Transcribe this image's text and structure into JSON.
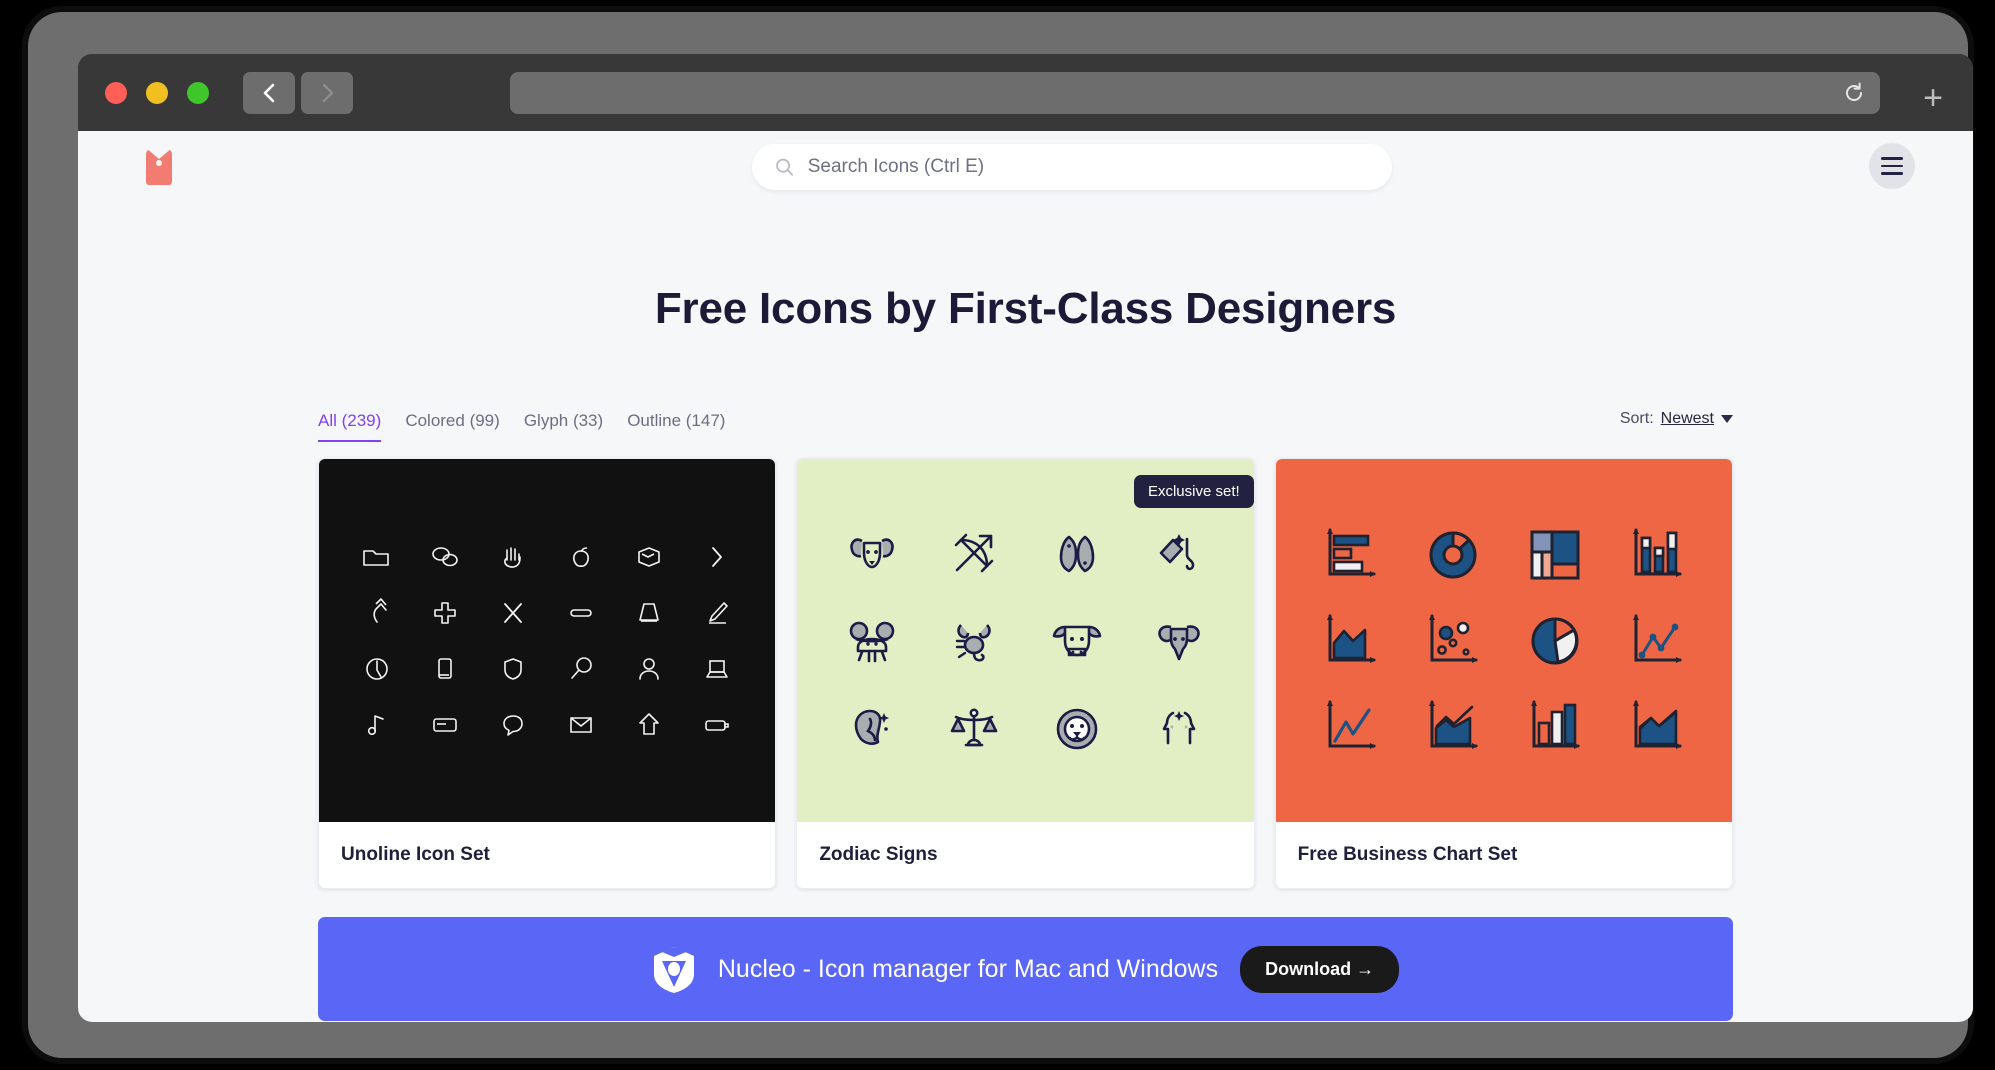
{
  "browser": {
    "traffic_lights": [
      "close",
      "minimize",
      "maximize"
    ],
    "back_label": "Back",
    "forward_label": "Forward",
    "url_value": "",
    "reload_label": "Reload",
    "newtab_label": "+"
  },
  "site": {
    "logo_name": "nucleo-tag-logo",
    "search": {
      "placeholder": "Search Icons (Ctrl E)",
      "value": ""
    },
    "menu_label": "Menu"
  },
  "headline": "Free Icons by First-Class Designers",
  "filters": {
    "tabs": [
      {
        "label": "All (239)",
        "active": true
      },
      {
        "label": "Colored (99)",
        "active": false
      },
      {
        "label": "Glyph (33)",
        "active": false
      },
      {
        "label": "Outline (147)",
        "active": false
      }
    ],
    "sort_label": "Sort:",
    "sort_value": "Newest"
  },
  "cards": [
    {
      "title": "Unoline Icon Set",
      "background": "#111111",
      "style": "outline-light",
      "badge": null,
      "icons": [
        "folder",
        "chat-bubbles",
        "hand-wave",
        "apple",
        "box-3d",
        "chevron-right",
        "arrow-up-curved",
        "plus",
        "scissors-x",
        "minus-pill",
        "lampshade",
        "pencil",
        "clock",
        "phone",
        "shield",
        "magnifier",
        "user",
        "laptop",
        "music-note",
        "credit-card",
        "speech-bubble",
        "envelope",
        "home-arrow",
        "battery"
      ]
    },
    {
      "title": "Zodiac Signs",
      "background": "#e2eec4",
      "style": "navy-filled",
      "badge": "Exclusive set!",
      "icons": [
        "aries-ram",
        "sagittarius-bow",
        "pisces-fish",
        "aquarius-jug",
        "cancer-crab",
        "scorpio-scorpion",
        "taurus-bull",
        "capricorn-goat",
        "virgo-maiden",
        "libra-scales",
        "leo-lion",
        "gemini-twins"
      ]
    },
    {
      "title": "Free Business Chart Set",
      "background": "#ef6644",
      "style": "navy-filled",
      "badge": null,
      "icons": [
        "horizontal-bar-chart",
        "donut-chart",
        "treemap-chart",
        "candlestick-chart",
        "area-chart",
        "bubble-chart",
        "pie-chart",
        "line-chart-points",
        "line-chart",
        "area-line-chart",
        "column-chart",
        "area-chart-alt"
      ]
    }
  ],
  "banner": {
    "logo_name": "nucleo-shield-logo",
    "text": "Nucleo - Icon manager for Mac and Windows",
    "button_label": "Download →",
    "background": "#5a66f5"
  },
  "colors": {
    "accent_purple": "#8341f5",
    "navy": "#1b1b38",
    "orange": "#ef6644",
    "green": "#e2eec4",
    "coral": "#f27c72",
    "banner_blue": "#5a66f5"
  }
}
